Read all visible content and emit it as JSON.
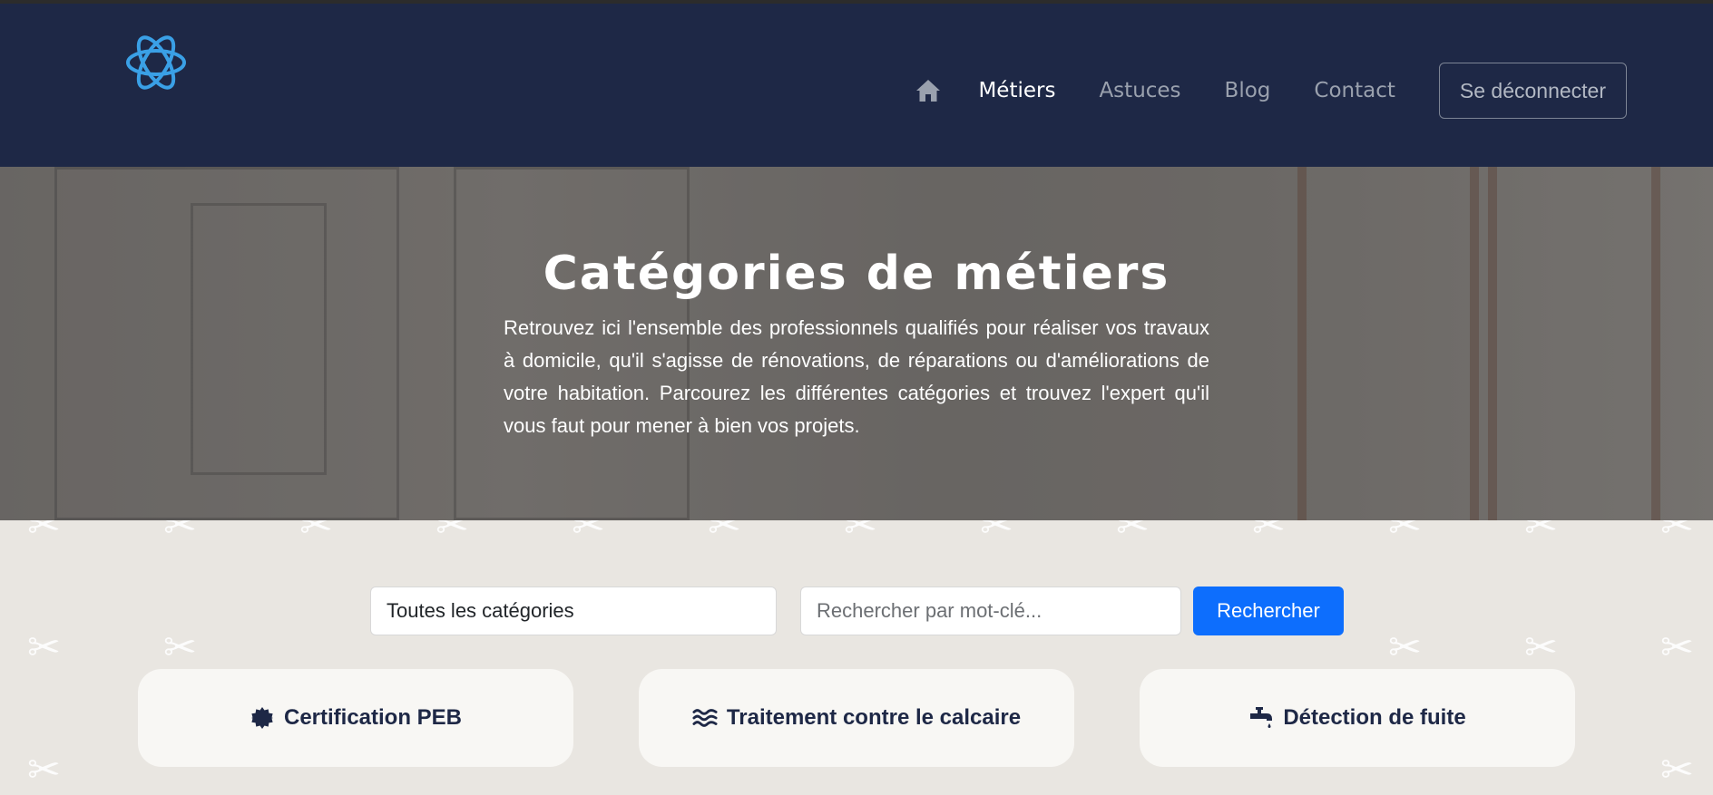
{
  "nav": {
    "home_label": "",
    "links": [
      {
        "label": "Métiers"
      },
      {
        "label": "Astuces"
      },
      {
        "label": "Blog"
      },
      {
        "label": "Contact"
      }
    ],
    "logout_label": "Se déconnecter"
  },
  "hero": {
    "title": "Catégories de métiers",
    "text": "Retrouvez ici l'ensemble des professionnels qualifiés pour réaliser vos travaux à domicile, qu'il s'agisse de rénovations, de réparations ou d'améliorations de votre habitation. Parcourez les différentes catégories et trouvez l'expert qu'il vous faut pour mener à bien vos projets."
  },
  "search": {
    "category_value": "Toutes les catégories",
    "placeholder": "Rechercher par mot-clé...",
    "button_label": "Rechercher"
  },
  "cards": [
    {
      "label": "Certification PEB",
      "icon": "certificate-icon"
    },
    {
      "label": "Traitement contre le calcaire",
      "icon": "water-waves-icon"
    },
    {
      "label": "Détection de fuite",
      "icon": "faucet-drip-icon"
    }
  ],
  "colors": {
    "navbar": "#1e2846",
    "accent": "#0d6efd",
    "logo": "#3aa0e6",
    "background": "#e9e6e1"
  }
}
